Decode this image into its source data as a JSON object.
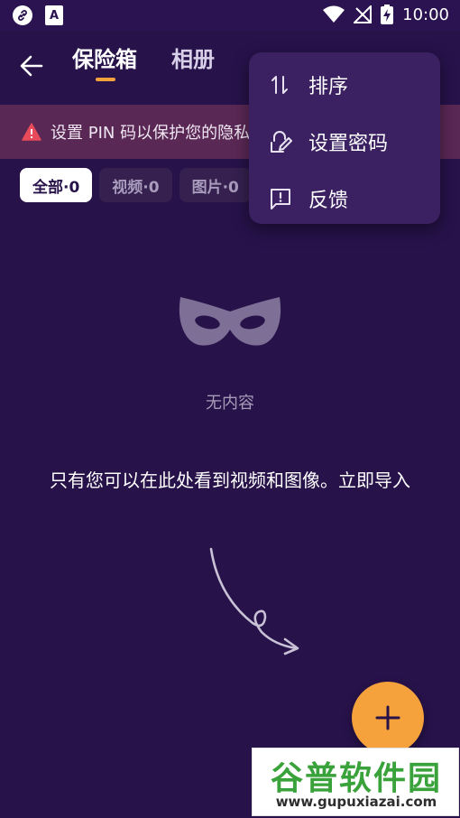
{
  "status_bar": {
    "time": "10:00",
    "left_icons": [
      "link-icon",
      "text-a-icon"
    ],
    "right_icons": [
      "wifi-icon",
      "no-signal-icon",
      "battery-charging-icon"
    ],
    "text_a_glyph": "A"
  },
  "header": {
    "back_icon": "arrow-left-icon",
    "tabs": [
      {
        "label": "保险箱",
        "active": true
      },
      {
        "label": "相册",
        "active": false
      }
    ],
    "accent_color": "#f5a23c"
  },
  "pin_banner": {
    "icon": "warning-icon",
    "text": "设置 PIN 码以保护您的隐私"
  },
  "filters": [
    {
      "label": "全部·0",
      "active": true
    },
    {
      "label": "视频·0",
      "active": false
    },
    {
      "label": "图片·0",
      "active": false
    }
  ],
  "empty_state": {
    "icon": "mask-icon",
    "title": "无内容",
    "description": "只有您可以在此处看到视频和图像。立即导入",
    "arrow_icon": "curved-arrow-icon"
  },
  "fab": {
    "icon": "plus-icon",
    "color": "#f5a23c"
  },
  "menu": {
    "items": [
      {
        "label": "排序",
        "icon": "sort-icon"
      },
      {
        "label": "设置密码",
        "icon": "edit-lock-icon"
      },
      {
        "label": "反馈",
        "icon": "feedback-icon"
      }
    ]
  },
  "watermark": {
    "title": "谷普软件园",
    "url": "www.gupuxiazai.com"
  },
  "colors": {
    "background": "#27124a",
    "banner": "#5a2855",
    "menu": "#3b2161"
  }
}
